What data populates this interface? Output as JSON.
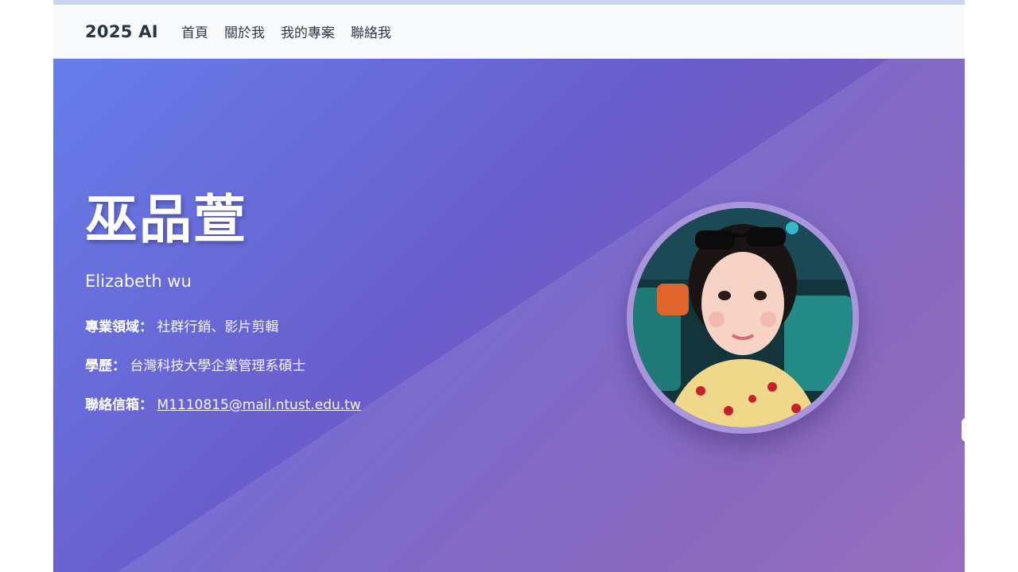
{
  "nav": {
    "brand": "2025 AI",
    "links": [
      "首頁",
      "關於我",
      "我的專案",
      "聯絡我"
    ]
  },
  "hero": {
    "name": "巫品萱",
    "subtitle": "Elizabeth wu",
    "info": [
      {
        "label": "專業領域：",
        "value": "社群行銷、影片剪輯"
      },
      {
        "label": "學歷：",
        "value": "台灣科技大學企業管理系碩士"
      },
      {
        "label": "聯絡信箱：",
        "value": "M1110815@mail.ntust.edu.tw"
      }
    ],
    "avatar_icon": "profile-photo"
  },
  "colors": {
    "gradient_start": "#667eea",
    "gradient_end": "#8a5fb6",
    "avatar_ring": "#a895dc",
    "nav_background": "#f8f9fb"
  }
}
